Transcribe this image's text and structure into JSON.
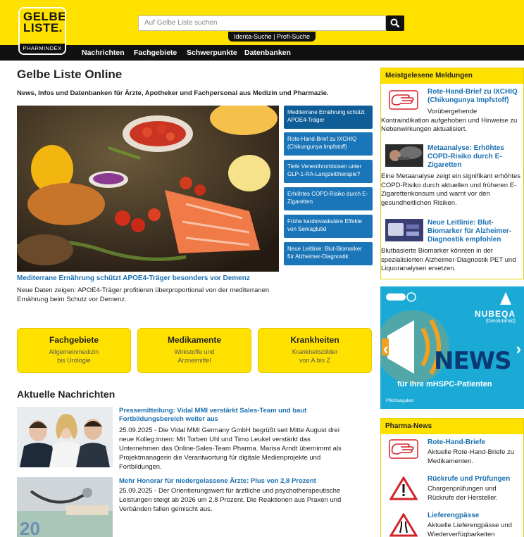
{
  "header": {
    "logo_line1": "GELBE",
    "logo_line2": "LISTE.",
    "logo_sub": "PHARMINDEX",
    "search_placeholder": "Auf Gelbe Liste suchen",
    "search_tag": "Identa-Suche | Profi-Suche",
    "nav": [
      "Nachrichten",
      "Fachgebiete",
      "Schwerpunkte",
      "Datenbanken"
    ]
  },
  "main": {
    "title": "Gelbe Liste Online",
    "intro": "News, Infos und Datenbanken für Ärzte, Apotheker und Fachpersonal aus Medizin und Pharmazie.",
    "hero_tabs": [
      "Mediterrane Ernährung schützt APOE4-Träger",
      "Rote-Hand-Brief zu IXCHIQ (Chikungunya Impfstoff)",
      "Tiefe Venenthrombosen unter GLP-1-RA-Langzeittherapie?",
      "Erhöhtes COPD-Risiko durch E-Zigaretten",
      "Frühe kardiovaskuläre Effekte von Semaglutid",
      "Neue Leitlinie: Blut-Biomarker für Alzheimer-Diagnostik"
    ],
    "hero_caption": "Mediterrane Ernährung schützt APOE4-Träger besonders vor Demenz",
    "hero_desc": "Neue Daten zeigen: APOE4-Träger profitieren überproportional von der mediterranen Ernährung beim Schutz vor Demenz.",
    "categories": [
      {
        "title": "Fachgebiete",
        "sub1": "Allgemeinmedizin",
        "sub2": "bis Urologie"
      },
      {
        "title": "Medikamente",
        "sub1": "Wirkstoffe und",
        "sub2": "Arzneimittel"
      },
      {
        "title": "Krankheiten",
        "sub1": "Krankheitsbilder",
        "sub2": "von A bis Z"
      }
    ],
    "news_heading": "Aktuelle Nachrichten",
    "news": [
      {
        "title": "Pressemitteilung: Vidal MMI verstärkt Sales-Team und baut Fortbildungsbereich weiter aus",
        "text": "25.09.2025 - Die Vidal MMI Germany GmbH begrüßt seit Mitte August drei neue Kolleg:innen: Mit Torben Uhl und Timo Leukel verstärkt das Unternehmen das Online-Sales-Team Pharma. Marisa Arndt übernimmt als Projektmanagerin die Verantwortung für digitale Medienprojekte und Fortbildungen."
      },
      {
        "title": "Mehr Honorar für niedergelassene Ärzte: Plus von 2,8 Prozent",
        "text": "25.09.2025 - Der Orientierungswert für ärztliche und psychotherapeutische Leistungen steigt ab 2026 um 2,8 Prozent. Die Reaktionen aus Praxen und Verbänden fallen gemischt aus."
      }
    ]
  },
  "sidebar": {
    "top_heading": "Meistgelesene Meldungen",
    "top": [
      {
        "title": "Rote-Hand-Brief zu IXCHIQ (Chikungunya Impfstoff)",
        "text": "Vorübergehende Kontraindikation aufgehoben und Hinweise zu Nebenwirkungen aktualisiert."
      },
      {
        "title": "Metaanalyse: Erhöhtes COPD-Risiko durch E-Zigaretten",
        "text": "Eine Metaanalyse zeigt ein signifikant erhöhtes COPD-Risiko durch aktuellen und früheren E-Zigarettenkonsum und warnt vor den gesundheitlichen Risiken."
      },
      {
        "title": "Neue Leitlinie: Blut-Biomarker für Alzheimer-Diagnostik empfohlen",
        "text": "Blutbasierte Biomarker könnten in der spezialisierten Alzheimer-Diagnostik PET und Liquoranalysen ersetzen."
      }
    ],
    "ad": {
      "brand": "NUBEQA",
      "brand_sub": "(Darolutamid)",
      "headline": "NEWS",
      "line": "für Ihre mHSPC-Patienten",
      "note": "Pflichtangaben"
    },
    "pharma_heading": "Pharma-News",
    "pharma": [
      {
        "title": "Rote-Hand-Briefe",
        "text": "Aktuelle Rote-Hand-Briefe zu Medikamenten."
      },
      {
        "title": "Rückrufe und Prüfungen",
        "text": "Chargenprüfungen und Rückrufe der Hersteller."
      },
      {
        "title": "Lieferengpässe",
        "text": "Aktuelle Lieferengpässe und Wiederverfügbarkeiten"
      }
    ]
  },
  "colors": {
    "brand_yellow": "#FFE100",
    "link_blue": "#1a6fb0",
    "tab_blue": "#1a76b8",
    "nav_black": "#111111"
  }
}
